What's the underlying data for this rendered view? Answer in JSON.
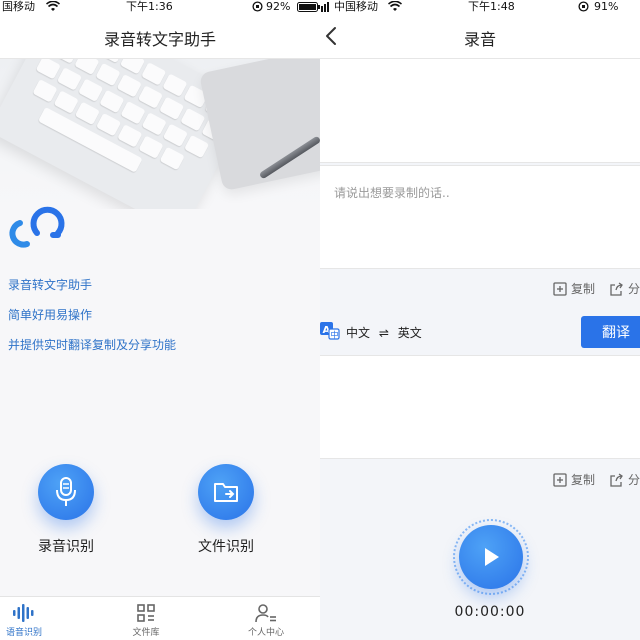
{
  "left": {
    "status": {
      "carrier": "国移动",
      "time": "下午1:36",
      "battery": "92%"
    },
    "title": "录音转文字助手",
    "features": [
      "录音转文字助手",
      "简单好用易操作",
      "并提供实时翻译复制及分享功能"
    ],
    "buttons": {
      "record": "录音识别",
      "file": "文件识别"
    },
    "tabs": [
      {
        "label": "语音识别",
        "icon": "waveform-icon"
      },
      {
        "label": "文件库",
        "icon": "grid-icon"
      },
      {
        "label": "个人中心",
        "icon": "user-icon"
      }
    ]
  },
  "right": {
    "status": {
      "carrier": "中国移动",
      "time": "下午1:48",
      "battery": "91%"
    },
    "title": "录音",
    "input_placeholder": "请说出想要录制的话..",
    "copy": "复制",
    "share": "分",
    "lang_from": "中文",
    "lang_swap": "⇌",
    "lang_to": "英文",
    "translate": "翻译",
    "timer": "00:00:00"
  },
  "colors": {
    "accent": "#2a73e8",
    "feature_text": "#2f73c8",
    "background": "#f3f5f9"
  }
}
